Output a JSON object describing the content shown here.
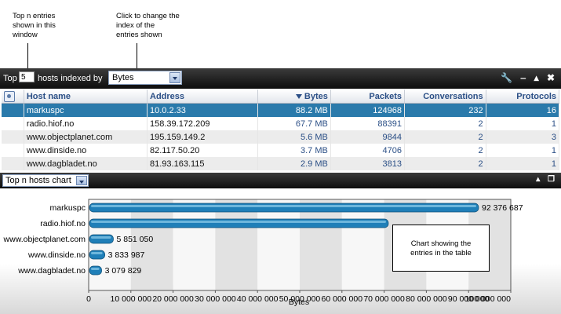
{
  "annotations": {
    "top_n": [
      "Top n entries",
      "shown in this",
      "window"
    ],
    "index_hint": [
      "Click to change the",
      "index of the",
      "entries shown"
    ],
    "chart_note": [
      "Chart showing the",
      "entries in the table"
    ]
  },
  "toolbar": {
    "top_label": "Top",
    "top_n_value": "5",
    "hosts_label": "hosts indexed by",
    "index_select": "Bytes",
    "icons": [
      "wrench-icon",
      "minimize-icon",
      "maximize-icon",
      "close-icon"
    ]
  },
  "table": {
    "columns": [
      "Host name",
      "Address",
      "Bytes",
      "Packets",
      "Conversations",
      "Protocols"
    ],
    "sorted_column": "Bytes",
    "rows": [
      {
        "host": "markuspc",
        "address": "10.0.2.33",
        "bytes": "88.2 MB",
        "packets": "124968",
        "conversations": "232",
        "protocols": "16",
        "selected": true
      },
      {
        "host": "radio.hiof.no",
        "address": "158.39.172.209",
        "bytes": "67.7 MB",
        "packets": "88391",
        "conversations": "2",
        "protocols": "1",
        "selected": false
      },
      {
        "host": "www.objectplanet.com",
        "address": "195.159.149.2",
        "bytes": "5.6 MB",
        "packets": "9844",
        "conversations": "2",
        "protocols": "3",
        "selected": false
      },
      {
        "host": "www.dinside.no",
        "address": "82.117.50.20",
        "bytes": "3.7 MB",
        "packets": "4706",
        "conversations": "2",
        "protocols": "1",
        "selected": false
      },
      {
        "host": "www.dagbladet.no",
        "address": "81.93.163.115",
        "bytes": "2.9 MB",
        "packets": "3813",
        "conversations": "2",
        "protocols": "1",
        "selected": false
      }
    ]
  },
  "chart_panel": {
    "select_value": "Top n hosts chart",
    "icons": [
      "collapse-icon",
      "restore-icon"
    ]
  },
  "chart_data": {
    "type": "bar",
    "orientation": "horizontal",
    "categories": [
      "markuspc",
      "radio.hiof.no",
      "www.objectplanet.com",
      "www.dinside.no",
      "www.dagbladet.no"
    ],
    "values": [
      92376687,
      71000000,
      5851050,
      3833987,
      3079829
    ],
    "value_labels": [
      "92 376 687",
      "",
      "5 851 050",
      "3 833 987",
      "3 079 829"
    ],
    "xlabel": "Bytes",
    "xlim": [
      0,
      100000000
    ],
    "xticks": [
      "0",
      "10 000 000",
      "20 000 000",
      "30 000 000",
      "40 000 000",
      "50 000 000",
      "60 000 000",
      "70 000 000",
      "80 000 000",
      "90 000 000",
      "100 000 000"
    ],
    "bar_color": "#1f7fb8",
    "grid": true
  }
}
